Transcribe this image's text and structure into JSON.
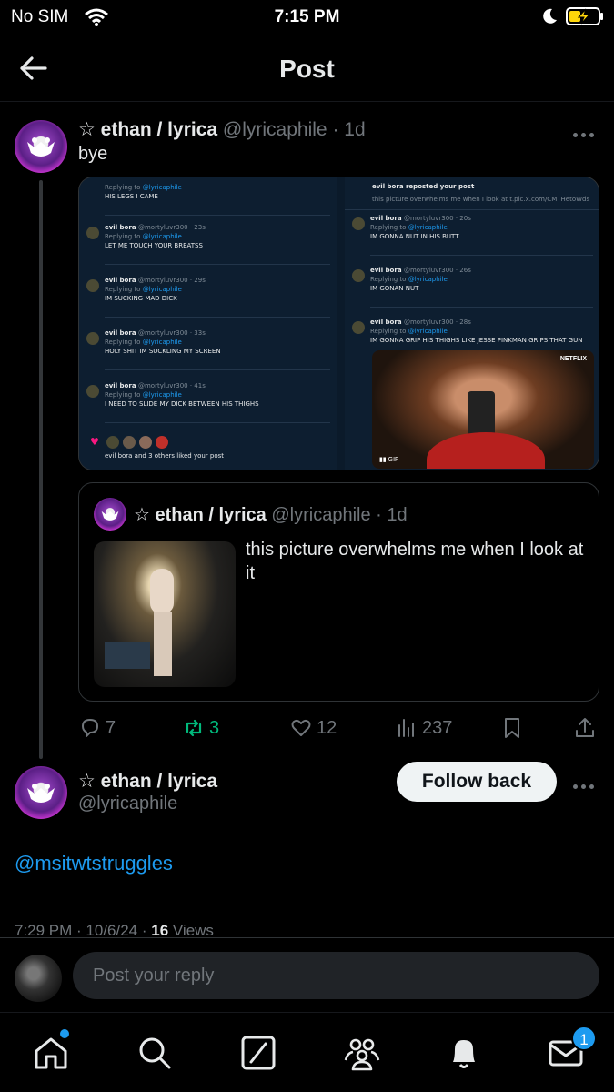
{
  "status_bar": {
    "carrier": "No SIM",
    "time": "7:15 PM"
  },
  "header": {
    "title": "Post"
  },
  "post": {
    "star": "☆",
    "name": "ethan / lyrica",
    "handle": "@lyricaphile",
    "dot": "·",
    "time": "1d",
    "text": "bye",
    "screenshots": {
      "left": [
        {
          "name": "",
          "handle": "",
          "reply": "Replying to",
          "to": "@lyricaphile",
          "text": "HIS LEGS I CAME"
        },
        {
          "name": "evil bora",
          "handle": "@mortyluvr300 · 23s",
          "reply": "Replying to",
          "to": "@lyricaphile",
          "text": "LET ME TOUCH YOUR BREATSS"
        },
        {
          "name": "evil bora",
          "handle": "@mortyluvr300 · 29s",
          "reply": "Replying to",
          "to": "@lyricaphile",
          "text": "IM SUCKING MAD DICK"
        },
        {
          "name": "evil bora",
          "handle": "@mortyluvr300 · 33s",
          "reply": "Replying to",
          "to": "@lyricaphile",
          "text": "HOLY SHIT IM SUCKLING MY SCREEN"
        },
        {
          "name": "evil bora",
          "handle": "@mortyluvr300 · 41s",
          "reply": "Replying to",
          "to": "@lyricaphile",
          "text": "I NEED TO SLIDE MY DICK BETWEEN HIS THIGHS"
        }
      ],
      "left_footer": "evil bora and 3 others liked your post",
      "right_header": "evil bora reposted your post",
      "right_header_sub": "this picture overwhelms me when I look at t.pic.x.com/CMTHetoWds",
      "right": [
        {
          "name": "evil bora",
          "handle": "@mortyluvr300 · 20s",
          "reply": "Replying to",
          "to": "@lyricaphile",
          "text": "IM GONNA NUT IN HIS BUTT"
        },
        {
          "name": "evil bora",
          "handle": "@mortyluvr300 · 26s",
          "reply": "Replying to",
          "to": "@lyricaphile",
          "text": "IM GONAN NUT"
        },
        {
          "name": "evil bora",
          "handle": "@mortyluvr300 · 28s",
          "reply": "Replying to",
          "to": "@lyricaphile",
          "text": "IM GONNA GRIP HIS THIGHS LIKE JESSE PINKMAN GRIPS THAT GUN"
        }
      ],
      "netflix_label": "NETFLIX",
      "gif_label": "GIF"
    },
    "quote": {
      "star": "☆",
      "name": "ethan / lyrica",
      "handle": "@lyricaphile",
      "dot": "·",
      "time": "1d",
      "text": "this picture overwhelms me when I look at it"
    },
    "actions": {
      "replies": "7",
      "reposts": "3",
      "likes": "12",
      "views": "237"
    }
  },
  "reply": {
    "star": "☆",
    "name": "ethan / lyrica",
    "handle": "@lyricaphile",
    "follow_label": "Follow back",
    "mention": "@msitwtstruggles",
    "meta_time": "7:29 PM · 10/6/24 · ",
    "meta_views": "16",
    "meta_views_label": " Views"
  },
  "reply_bar": {
    "placeholder": "Post your reply"
  },
  "tabbar": {
    "messages_badge": "1"
  },
  "colors": {
    "accent": "#1d9bf0",
    "repost_green": "#00ba7c",
    "muted": "#71767b"
  }
}
